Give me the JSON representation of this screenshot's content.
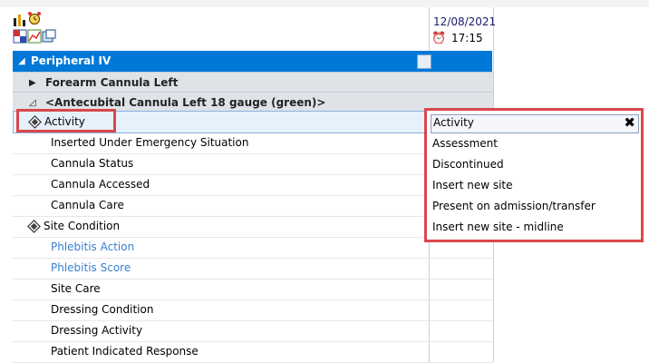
{
  "header": {
    "date": "12/08/2021",
    "time": "17:15"
  },
  "section": {
    "label": "Peripheral IV"
  },
  "subsections": [
    {
      "label": "Forearm Cannula Left",
      "state": "collapsed"
    },
    {
      "label": "<Antecubital Cannula Left 18 gauge (green)>",
      "state": "expanded"
    }
  ],
  "items": [
    {
      "label": "Activity",
      "selected": true,
      "diamond": true
    },
    {
      "label": "Inserted Under Emergency Situation"
    },
    {
      "label": "Cannula Status"
    },
    {
      "label": "Cannula Accessed"
    },
    {
      "label": "Cannula Care"
    },
    {
      "label": "Site Condition",
      "diamond": true
    },
    {
      "label": "Phlebitis Action",
      "color": "#3a7fd0"
    },
    {
      "label": "Phlebitis Score",
      "color": "#3a7fd0"
    },
    {
      "label": "Site Care"
    },
    {
      "label": "Dressing Condition"
    },
    {
      "label": "Dressing Activity"
    },
    {
      "label": "Patient Indicated Response"
    }
  ],
  "dropdown": {
    "title": "Activity",
    "close": "✖",
    "options": [
      "Assessment",
      "Discontinued",
      "Insert new site",
      "Present on admission/transfer",
      "Insert new site - midline"
    ]
  },
  "colors": {
    "section_bg": "#0078d7",
    "highlight_border": "#d9474c",
    "link_text": "#3a7fd0"
  }
}
